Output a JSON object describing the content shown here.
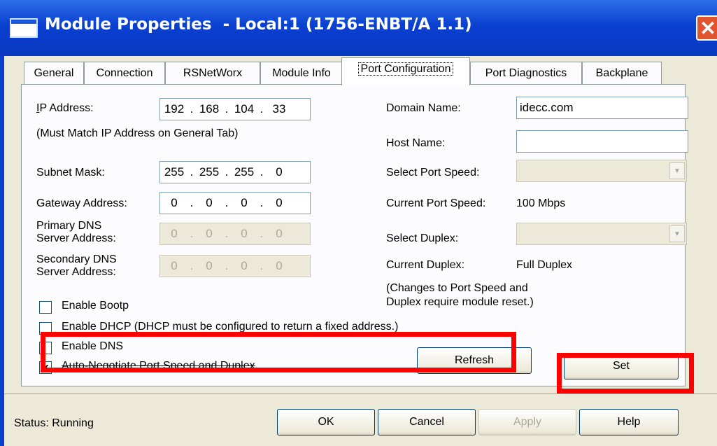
{
  "window": {
    "title": "Module Properties  - Local:1 (1756-ENBT/A 1.1)",
    "close_glyph": "✕"
  },
  "tabs": [
    {
      "label": "General"
    },
    {
      "label": "Connection"
    },
    {
      "label": "RSNetWorx"
    },
    {
      "label": "Module Info"
    },
    {
      "label": "Port Configuration"
    },
    {
      "label": "Port Diagnostics"
    },
    {
      "label": "Backplane"
    }
  ],
  "active_tab": "Port Configuration",
  "left": {
    "ip_label": "IP Address:",
    "ip": [
      "192",
      "168",
      "104",
      "33"
    ],
    "ip_note": "(Must Match IP Address on General Tab)",
    "subnet_label": "Subnet Mask:",
    "subnet": [
      "255",
      "255",
      "255",
      "0"
    ],
    "gateway_label": "Gateway Address:",
    "gateway": [
      "0",
      "0",
      "0",
      "0"
    ],
    "primary_dns_label_1": "Primary DNS",
    "primary_dns_label_2": "Server Address:",
    "primary_dns": [
      "0",
      "0",
      "0",
      "0"
    ],
    "secondary_dns_label_1": "Secondary DNS",
    "secondary_dns_label_2": "Server Address:",
    "secondary_dns": [
      "0",
      "0",
      "0",
      "0"
    ],
    "dot": "."
  },
  "right": {
    "domain_label": "Domain Name:",
    "domain_value": "idecc.com",
    "host_label": "Host Name:",
    "host_value": "",
    "port_speed_label": "Select Port Speed:",
    "current_speed_label": "Current Port Speed:",
    "current_speed_value": "100 Mbps",
    "duplex_label": "Select Duplex:",
    "current_duplex_label": "Current Duplex:",
    "current_duplex_value": "Full Duplex",
    "note_1": "(Changes to Port Speed and",
    "note_2": "Duplex require module reset.)",
    "combo_arrow": "▼"
  },
  "checkboxes": [
    {
      "label": "Enable Bootp",
      "checked": false
    },
    {
      "label": "Enable DHCP  (DHCP must be configured to return a fixed address.)",
      "checked": false
    },
    {
      "label": "Enable DNS",
      "checked": false
    },
    {
      "label": "Auto-Negotiate Port Speed and Duplex",
      "checked": true
    }
  ],
  "check_mark": "✔",
  "buttons": {
    "refresh": "Refresh",
    "set": "Set",
    "ok": "OK",
    "cancel": "Cancel",
    "apply": "Apply",
    "help": "Help"
  },
  "status": "Status:  Running",
  "colors": {
    "titlebar": "#0a3fd0",
    "highlight": "#ff0000",
    "dialog_bg": "#ece9d8"
  }
}
